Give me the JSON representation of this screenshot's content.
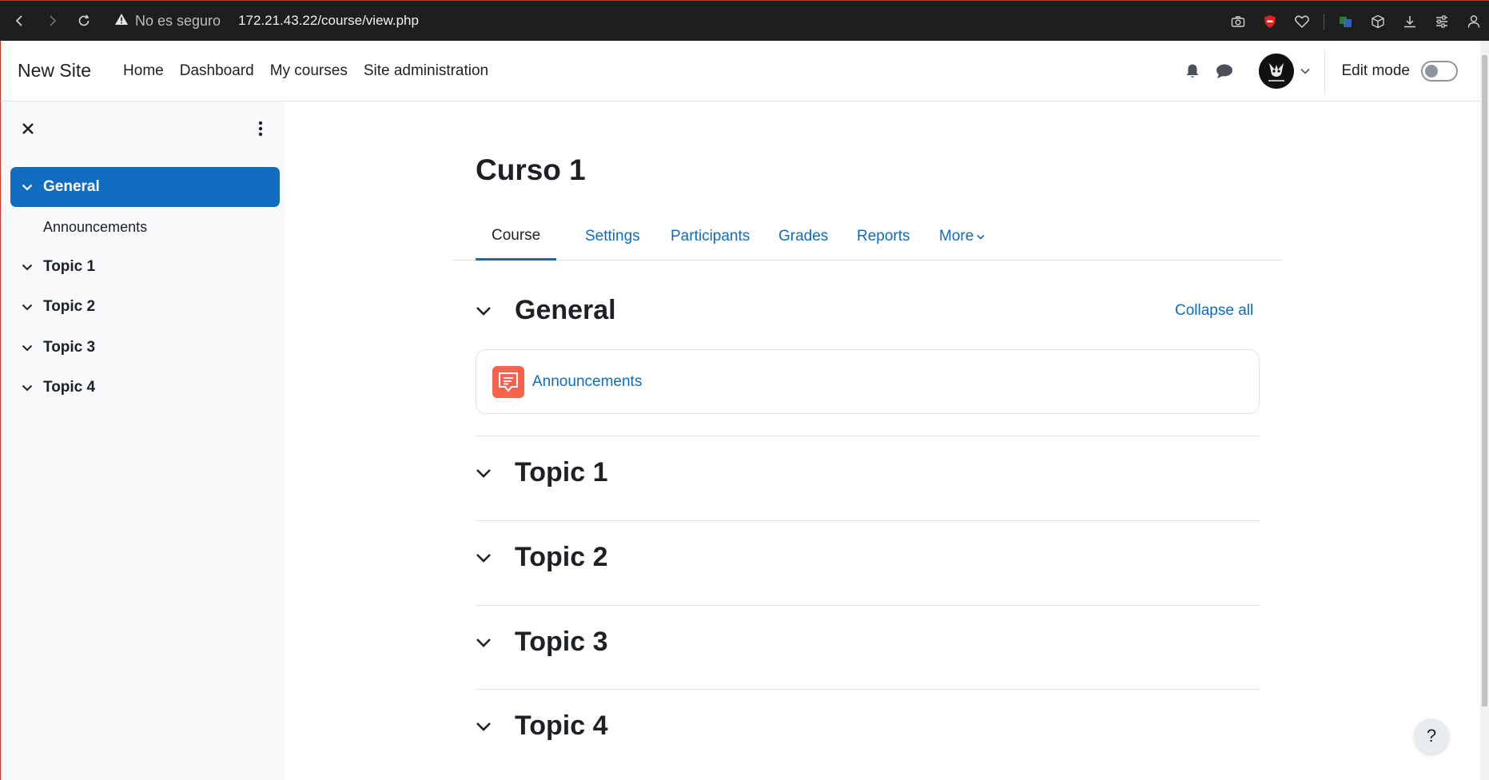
{
  "browser": {
    "security_label": "No es seguro",
    "url": "172.21.43.22/course/view.php"
  },
  "header": {
    "brand": "New Site",
    "nav": [
      "Home",
      "Dashboard",
      "My courses",
      "Site administration"
    ],
    "edit_mode_label": "Edit mode",
    "edit_mode_on": false
  },
  "course_index": {
    "sections": [
      {
        "name": "General",
        "active": true,
        "items": [
          "Announcements"
        ]
      },
      {
        "name": "Topic 1",
        "active": false,
        "items": []
      },
      {
        "name": "Topic 2",
        "active": false,
        "items": []
      },
      {
        "name": "Topic 3",
        "active": false,
        "items": []
      },
      {
        "name": "Topic 4",
        "active": false,
        "items": []
      }
    ]
  },
  "course": {
    "title": "Curso 1",
    "tabs": [
      "Course",
      "Settings",
      "Participants",
      "Grades",
      "Reports",
      "More"
    ],
    "active_tab": "Course",
    "collapse_all_label": "Collapse all",
    "sections": [
      {
        "name": "General",
        "activities": [
          "Announcements"
        ]
      },
      {
        "name": "Topic 1",
        "activities": []
      },
      {
        "name": "Topic 2",
        "activities": []
      },
      {
        "name": "Topic 3",
        "activities": []
      },
      {
        "name": "Topic 4",
        "activities": []
      }
    ]
  },
  "help_label": "?",
  "colors": {
    "primary": "#0f6cbf",
    "forum_icon": "#f7634d",
    "drawer_bg": "#f8f9fa",
    "browser_bar": "#1e1e1e"
  }
}
